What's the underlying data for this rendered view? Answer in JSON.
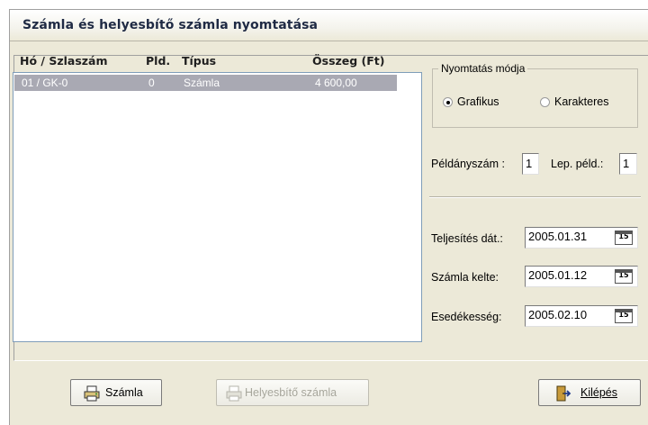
{
  "window": {
    "title": "Számla és helyesbítő számla nyomtatása"
  },
  "list": {
    "columns": [
      "Hó / Szlaszám",
      "Pld.",
      "Típus",
      "Összeg (Ft)"
    ],
    "rows": [
      {
        "ho_szlaszam": "01 / GK-0",
        "pld": "0",
        "tipus": "Számla",
        "osszeg": "4 600,00"
      }
    ]
  },
  "print_mode": {
    "legend": "Nyomtatás módja",
    "options": [
      {
        "label": "Grafikus",
        "selected": true
      },
      {
        "label": "Karakteres",
        "selected": false
      }
    ]
  },
  "copies": {
    "label": "Példányszám :",
    "value": "1",
    "lep_label": "Lep. péld.:",
    "lep_value": "1"
  },
  "dates": {
    "teljesites_label": "Teljesítés dát.:",
    "teljesites_value": "2005.01.31",
    "kelte_label": "Számla kelte:",
    "kelte_value": "2005.01.12",
    "esedekesseg_label": "Esedékesség:",
    "esedekesseg_value": "2005.02.10",
    "calendar_icon_text": "15"
  },
  "buttons": {
    "szamla": "Számla",
    "helyesbito": "Helyesbítő számla",
    "kilepes": "Kilépés"
  },
  "colors": {
    "selection": "#a9a9b3",
    "window_bg": "#ece9d8"
  }
}
